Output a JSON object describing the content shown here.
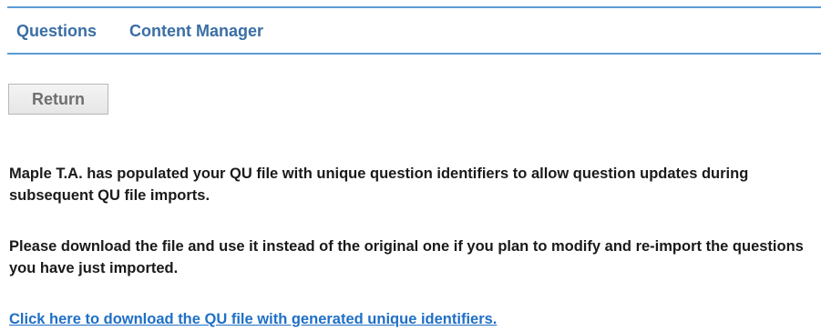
{
  "nav": {
    "tabs": [
      {
        "label": "Questions"
      },
      {
        "label": "Content Manager"
      }
    ]
  },
  "actions": {
    "return_label": "Return"
  },
  "messages": {
    "populated": "Maple T.A. has populated your QU file with unique question identifiers to allow question updates during subsequent QU file imports.",
    "instruction": "Please download the file and use it instead of the original one if you plan to modify and re-import the questions you have just imported."
  },
  "download": {
    "link_text": "Click here to download the QU file with generated unique identifiers."
  },
  "colors": {
    "nav_border": "#5b9bd5",
    "nav_text": "#3a6ea5",
    "link": "#1f6fc6"
  }
}
